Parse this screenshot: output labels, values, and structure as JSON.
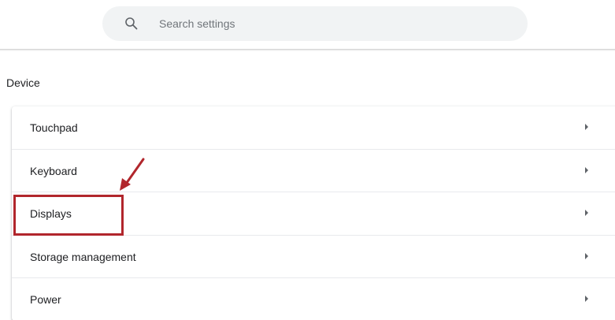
{
  "search": {
    "placeholder": "Search settings",
    "icon": "search-icon"
  },
  "section": {
    "title": "Device"
  },
  "device_items": [
    {
      "label": "Touchpad",
      "icon": "chevron-right-icon"
    },
    {
      "label": "Keyboard",
      "icon": "chevron-right-icon"
    },
    {
      "label": "Displays",
      "icon": "chevron-right-icon"
    },
    {
      "label": "Storage management",
      "icon": "chevron-right-icon"
    },
    {
      "label": "Power",
      "icon": "chevron-right-icon"
    }
  ],
  "annotation": {
    "target": "Displays",
    "color": "#b1262c",
    "icon": "arrow-down-left-icon"
  },
  "colors": {
    "search_bg": "#f1f3f4",
    "text": "#202124",
    "placeholder": "#70757a"
  }
}
